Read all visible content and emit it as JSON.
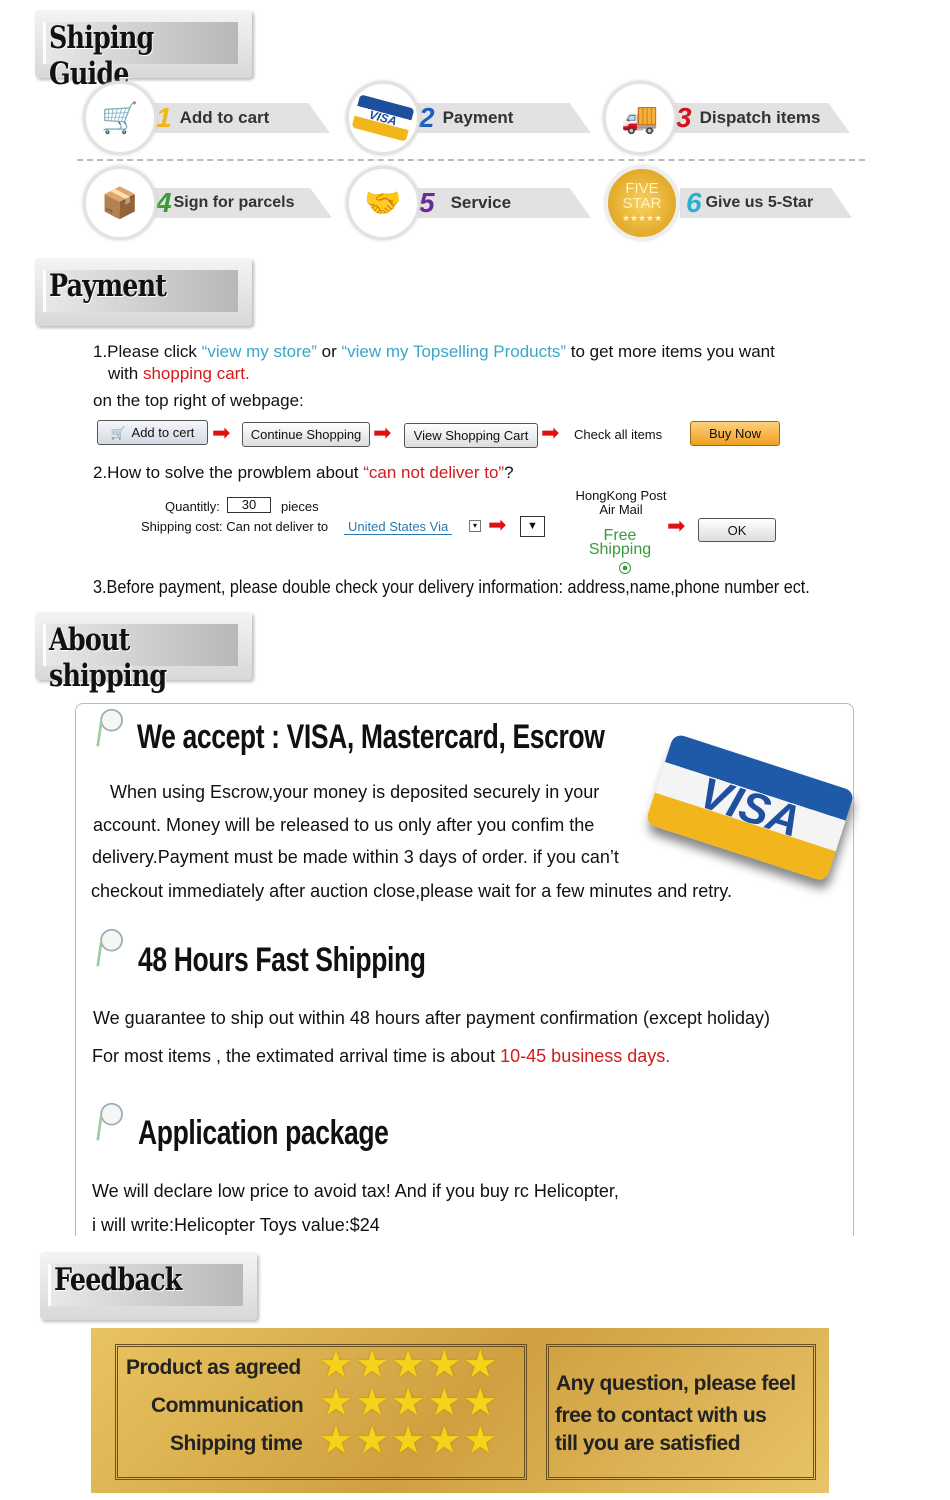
{
  "headers": {
    "shipping_guide": "Shiping Guide",
    "payment": "Payment",
    "about_shipping": "About shipping",
    "feedback": "Feedback"
  },
  "steps": [
    {
      "num": "1",
      "label": "Add to cart",
      "color": "#f2b51c",
      "icon": "cart-icon"
    },
    {
      "num": "2",
      "label": "Payment",
      "color": "#1e5fbf",
      "icon": "visa-card-icon"
    },
    {
      "num": "3",
      "label": "Dispatch items",
      "color": "#d0141e",
      "icon": "delivery-truck-icon"
    },
    {
      "num": "4",
      "label": "Sign for parcels",
      "color": "#3a9a3a",
      "icon": "courier-icon"
    },
    {
      "num": "5",
      "label": "Service",
      "color": "#6a2a9a",
      "icon": "handshake-icon"
    },
    {
      "num": "6",
      "label": "Give us 5-Star",
      "color": "#2ab0d0",
      "icon": "five-star-badge-icon"
    }
  ],
  "five_star_badge": {
    "line1": "FIVE",
    "line2": "STAR",
    "stars": "★★★★★"
  },
  "visa_text": "VISA",
  "payment": {
    "l1_a": "1.Please click ",
    "l1_link1": "“view my store”",
    "l1_b": " or ",
    "l1_link2": "“view my Topselling Products”",
    "l1_c": " to get more items you want",
    "l2_a": "with ",
    "l2_red": "shopping cart.",
    "l3": "on the top right of webpage:",
    "buttons": {
      "add": "Add to cert",
      "continue": "Continue Shopping",
      "view": "View Shopping Cart",
      "check": "Check all items",
      "buy": "Buy Now"
    },
    "q2_a": "2.How to solve the prowblem about ",
    "q2_red": "“can not deliver to”",
    "q2_b": "?",
    "quantity_label": "Quantitly:",
    "quantity_value": "30",
    "pieces": "pieces",
    "shipping_label": "Shipping cost: Can not deliver to",
    "shipping_link": "United States Via",
    "hk1": "HongKong Post",
    "hk2": "Air Mail",
    "free1": "Free",
    "free2": "Shipping",
    "ok": "OK",
    "q3": "3.Before payment, please double check your delivery information: address,name,phone number ect."
  },
  "about": {
    "accept_title": "We accept : VISA, Mastercard, Escrow",
    "accept_lines": [
      "When using Escrow,your money is deposited securely in your",
      "account. Money will be released to us only after you confim the",
      "delivery.Payment must be made within 3 days of order. if you can’t",
      "checkout immediately after auction close,please wait for a few minutes and retry."
    ],
    "fast_title": "48 Hours Fast Shipping",
    "fast_line1": "We guarantee to ship out within 48 hours after payment confirmation (except holiday)",
    "fast_line2_a": "For most items , the extimated arrival time is about ",
    "fast_line2_red": "10-45 business days.",
    "pkg_title": "Application package",
    "pkg_lines": [
      "We will declare low price to avoid tax! And if you buy rc Helicopter,",
      "i will write:Helicopter Toys value:$24"
    ]
  },
  "feedback": {
    "rows": [
      {
        "label": "Product as agreed",
        "stars": 5
      },
      {
        "label": "Communication",
        "stars": 5
      },
      {
        "label": "Shipping time",
        "stars": 5
      }
    ],
    "star_glyphs": "★★★★★",
    "note": [
      "Any question, please feel",
      "free to contact with us",
      "till you are satisfied"
    ]
  },
  "colors": {
    "link": "#3aa6c8",
    "red": "#d41a1a",
    "gold": "#d9b048",
    "green": "#3a9a3a"
  }
}
